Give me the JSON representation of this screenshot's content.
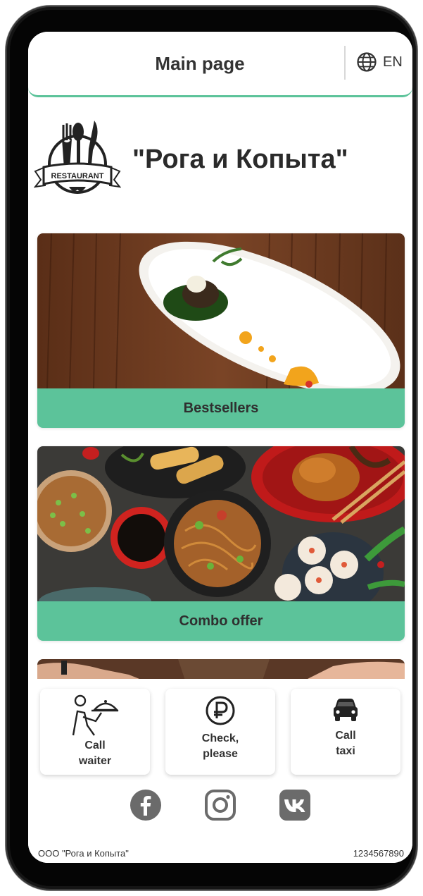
{
  "header": {
    "title": "Main page",
    "language": "EN",
    "language_icon": "globe-icon"
  },
  "brand": {
    "name": "\"Рога и Копыта\"",
    "logo_text": "RESTAURANT"
  },
  "categories": [
    {
      "label": "Bestsellers"
    },
    {
      "label": "Combo offer"
    }
  ],
  "actions": [
    {
      "icon": "waiter-icon",
      "label_lines": [
        "Call",
        "waiter"
      ]
    },
    {
      "icon": "ruble-icon",
      "label_lines": [
        "Check,",
        "please"
      ]
    },
    {
      "icon": "car-icon",
      "label_lines": [
        "Call",
        "taxi"
      ]
    }
  ],
  "socials": [
    {
      "icon": "facebook-icon"
    },
    {
      "icon": "instagram-icon"
    },
    {
      "icon": "vk-icon"
    }
  ],
  "footer": {
    "company": "ООО \"Рога и Копыта\"",
    "phone": "1234567890"
  },
  "colors": {
    "accent": "#5cc39a",
    "text": "#333333",
    "icon_gray": "#6b6b6b"
  }
}
